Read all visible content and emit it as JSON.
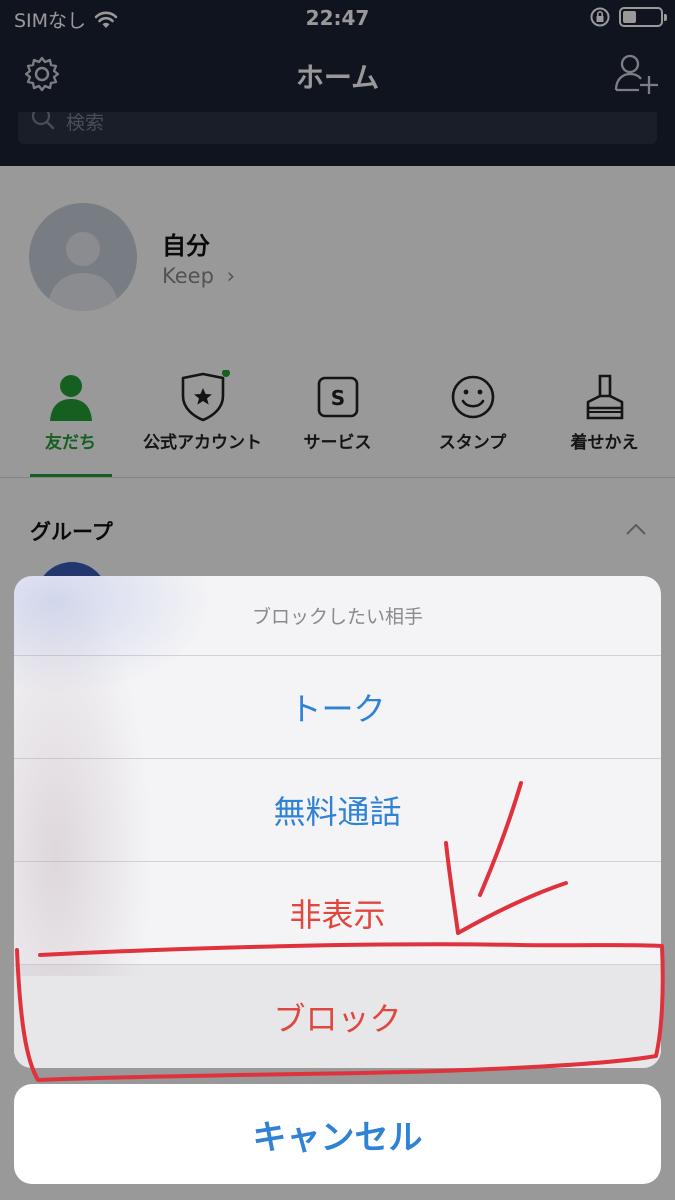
{
  "status_bar": {
    "carrier": "SIMなし",
    "time": "22:47",
    "battery_level": 0.35
  },
  "nav": {
    "title": "ホーム",
    "search_placeholder": "検索"
  },
  "profile": {
    "name": "自分",
    "keep_label": "Keep",
    "keep_chevron": "›"
  },
  "tabs": [
    {
      "label": "友だち",
      "icon": "person-icon",
      "active": true
    },
    {
      "label": "公式アカウント",
      "icon": "shield-star-icon",
      "active": false
    },
    {
      "label": "サービス",
      "icon": "service-s-icon",
      "active": false
    },
    {
      "label": "スタンプ",
      "icon": "smiley-icon",
      "active": false
    },
    {
      "label": "着せかえ",
      "icon": "brush-icon",
      "active": false
    }
  ],
  "group_section": {
    "title": "グループ"
  },
  "action_sheet": {
    "title": "ブロックしたい相手",
    "items": [
      {
        "label": "トーク",
        "style": "normal"
      },
      {
        "label": "無料通話",
        "style": "normal"
      },
      {
        "label": "非表示",
        "style": "destructive"
      },
      {
        "label": "ブロック",
        "style": "destructive"
      }
    ],
    "cancel_label": "キャンセル"
  },
  "colors": {
    "header_bg": "#1c2232",
    "accent_green": "#24a137",
    "action_blue": "#2f82d4",
    "destructive_red": "#e0473f",
    "annotation_red": "#e0323c"
  }
}
